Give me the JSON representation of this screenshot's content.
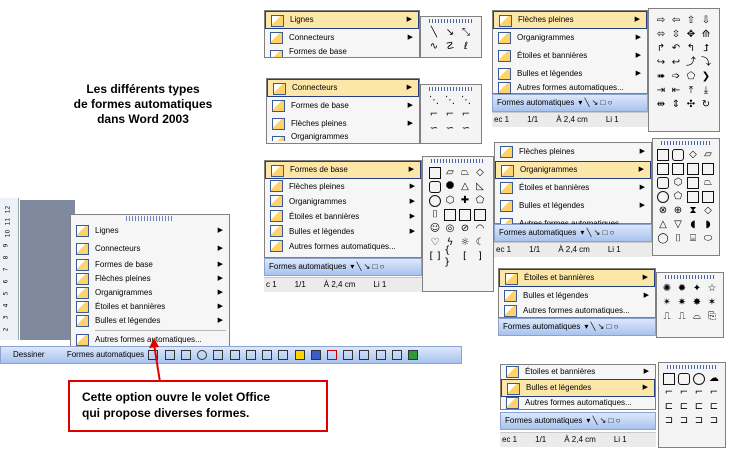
{
  "title": {
    "line1": "Les différents types",
    "line2": "de formes automatiques",
    "line3": "dans Word 2003"
  },
  "callout": {
    "line1": "Cette option ouvre le volet  Office",
    "line2": "qui propose diverses formes."
  },
  "menu_items": [
    "Lignes",
    "Connecteurs",
    "Formes de base",
    "Flèches pleines",
    "Organigrammes",
    "Étoiles et bannières",
    "Bulles et légendes",
    "Autres formes automatiques..."
  ],
  "toolbar": {
    "draw": "Dessiner",
    "autoshapes": "Formes automatiques"
  },
  "status": {
    "sec": "ec 1",
    "page": "1/1",
    "pos": "À 2,4 cm",
    "line": "Li 1",
    "sec_b": "c 1"
  },
  "ruler_numbers": [
    "12",
    "11",
    "10",
    "9",
    "8",
    "7",
    "6",
    "5",
    "4",
    "3",
    "2",
    "1"
  ],
  "colors": {
    "highlight": "#fde7a8",
    "callout": "#e00000",
    "toolbar": "#a9c3ee"
  }
}
